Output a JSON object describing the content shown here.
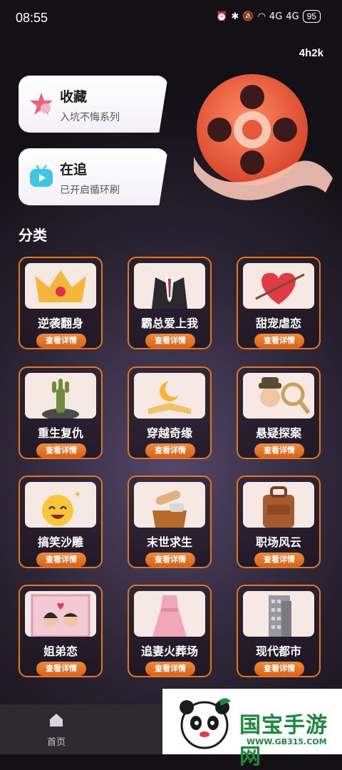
{
  "status": {
    "time": "08:55",
    "battery": "95",
    "signal_a": "4G",
    "signal_b": "4G"
  },
  "speed": "4h2k",
  "cards": [
    {
      "title": "收藏",
      "subtitle": "入坑不悔系列",
      "icon": "star-icon"
    },
    {
      "title": "在追",
      "subtitle": "已开启循环刷",
      "icon": "tv-icon"
    }
  ],
  "section_title": "分类",
  "button_label": "查看详情",
  "categories": [
    {
      "name": "逆袭翻身",
      "icon": "crown-icon"
    },
    {
      "name": "霸总爱上我",
      "icon": "suit-icon"
    },
    {
      "name": "甜宠虐恋",
      "icon": "heart-arrow-icon"
    },
    {
      "name": "重生复仇",
      "icon": "zombie-hand-icon"
    },
    {
      "name": "穿越奇缘",
      "icon": "moon-book-icon"
    },
    {
      "name": "悬疑探案",
      "icon": "detective-icon"
    },
    {
      "name": "搞笑沙雕",
      "icon": "laughing-face-icon"
    },
    {
      "name": "末世求生",
      "icon": "survival-icon"
    },
    {
      "name": "职场风云",
      "icon": "briefcase-icon"
    },
    {
      "name": "姐弟恋",
      "icon": "couple-icon"
    },
    {
      "name": "追妻火葬场",
      "icon": "dress-icon"
    },
    {
      "name": "现代都市",
      "icon": "building-icon"
    }
  ],
  "nav": {
    "home_label": "首页"
  },
  "watermark": {
    "text": "国宝手游网",
    "url": "WWW.GB315.COM"
  },
  "colors": {
    "accent": "#e8761f",
    "brand": "#1b8a3c"
  }
}
